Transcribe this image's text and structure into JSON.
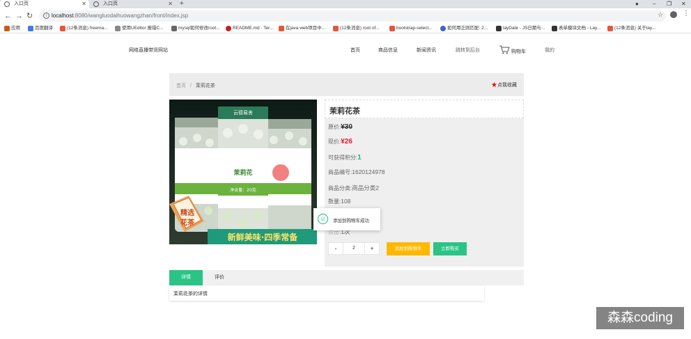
{
  "browser": {
    "tabs": [
      {
        "title": "入口页",
        "active": true
      },
      {
        "title": "入口页",
        "active": false
      }
    ],
    "url_host": "localhost",
    "url_rest": ":8080/wangluodaihuowangzhan/front/index.jsp",
    "bookmarks": [
      {
        "label": "应用",
        "color": "#c95a1a"
      },
      {
        "label": "百度翻译",
        "color": "#3d7bf2"
      },
      {
        "label": "(12条消息) freema...",
        "color": "#e8543a"
      },
      {
        "label": "使用UEditor 报错C...",
        "color": "#888888"
      },
      {
        "label": "mysql如何修改root...",
        "color": "#666666"
      },
      {
        "label": "README.md · Ter...",
        "color": "#c71d23"
      },
      {
        "label": "在java web项目中...",
        "color": "#e8543a"
      },
      {
        "label": "(12条消息) root of...",
        "color": "#e8543a"
      },
      {
        "label": "bootstrap-select...",
        "color": "#e8543a"
      },
      {
        "label": "如何用正则匹配: 2...",
        "color": "#3f63d3"
      },
      {
        "label": "layDate - JS日期与...",
        "color": "#333333"
      },
      {
        "label": "表单模块文档 - Lay...",
        "color": "#333333"
      },
      {
        "label": "(12条消息) 关于lay...",
        "color": "#e8543a"
      }
    ]
  },
  "header": {
    "site_title": "网络直播带货网站",
    "nav": [
      "首页",
      "商品信息",
      "新闻资讯",
      "跳转到后台",
      "购物车",
      "我的"
    ]
  },
  "breadcrumb": {
    "home": "首页",
    "sep": "/",
    "current": "茉莉花茶"
  },
  "favorite_label": "点我收藏",
  "product": {
    "name": "茉莉花茶",
    "image_texts": {
      "brand": "云德易舍",
      "label": "茉莉花",
      "weight": "净含量：20克",
      "badge_top": "精选",
      "badge_bottom": "花茶",
      "slogan": "新鲜美味·四季常备"
    },
    "original_label": "原价:",
    "original_price": "¥30",
    "price_label": "现价:",
    "price": "¥26",
    "points_label": "可获得积分:",
    "points": "1",
    "code_label": "商品编号:",
    "code": "1620124978",
    "category_label": "商品分类:",
    "category": "商品分类2",
    "stock_label": "数量:",
    "stock": "108",
    "clicks_label": "点击:",
    "clicks": "1次",
    "quantity": "2",
    "minus": "-",
    "plus": "+",
    "add_cart_label": "添加到购物车",
    "buy_now_label": "立即购买"
  },
  "toast": {
    "text": "添加到购物车成功"
  },
  "tabs": {
    "detail": "详情",
    "review": "评价"
  },
  "detail_text": "茉莉花茶的详情",
  "watermark": "森森coding"
}
